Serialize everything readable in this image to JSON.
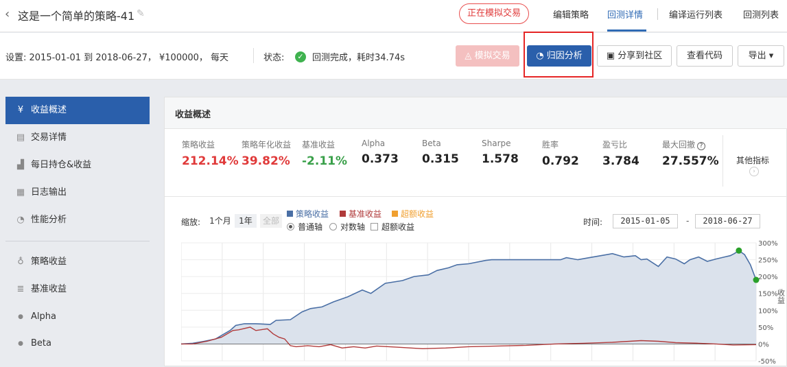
{
  "header": {
    "back_icon": "chevron-left-icon",
    "title": "这是一个简单的策略-41",
    "edit_icon": "pencil-icon",
    "sim_badge": "正在模拟交易",
    "tabs": [
      {
        "label": "编辑策略"
      },
      {
        "label": "回测详情",
        "active": true
      },
      {
        "label": "编译运行列表"
      },
      {
        "label": "回测列表"
      }
    ]
  },
  "info": {
    "settings": "设置:   2015-01-01 到 2018-06-27，  ¥100000，  每天",
    "status_label": "状态:",
    "status_icon": "check-circle-icon",
    "status_text": "回测完成，耗时34.74s",
    "buttons": {
      "sim_trade": "模拟交易",
      "attribution": "归因分析",
      "share": "分享到社区",
      "view_code": "查看代码",
      "export": "导出"
    }
  },
  "sidebar": {
    "items": [
      {
        "label": "收益概述",
        "icon": "yen-icon",
        "active": true
      },
      {
        "label": "交易详情",
        "icon": "document-icon"
      },
      {
        "label": "每日持仓&收益",
        "icon": "bar-chart-icon"
      },
      {
        "label": "日志输出",
        "icon": "calendar-icon"
      },
      {
        "label": "性能分析",
        "icon": "pie-chart-icon"
      },
      {
        "label": "策略收益",
        "icon": "lightbulb-icon"
      },
      {
        "label": "基准收益",
        "icon": "database-icon"
      },
      {
        "label": "Alpha"
      },
      {
        "label": "Beta"
      }
    ]
  },
  "panel": {
    "title": "收益概述",
    "metrics": [
      {
        "label": "策略收益",
        "value": "212.14%",
        "color": "#e03a3a"
      },
      {
        "label": "策略年化收益",
        "value": "39.82%",
        "color": "#e03a3a"
      },
      {
        "label": "基准收益",
        "value": "-2.11%",
        "color": "#3aa04a"
      },
      {
        "label": "Alpha",
        "value": "0.373"
      },
      {
        "label": "Beta",
        "value": "0.315"
      },
      {
        "label": "Sharpe",
        "value": "1.578"
      },
      {
        "label": "胜率",
        "value": "0.792"
      },
      {
        "label": "盈亏比",
        "value": "3.784"
      },
      {
        "label": "最大回撤",
        "value": "27.557%"
      }
    ],
    "other_metrics": "其他指标"
  },
  "chart_controls": {
    "zoom_label": "缩放:",
    "zoom_options": [
      "1个月",
      "1年",
      "全部"
    ],
    "legend": [
      {
        "name": "策略收益",
        "color": "#4a6fa5"
      },
      {
        "name": "基准收益",
        "color": "#b03a3a"
      },
      {
        "name": "超额收益",
        "color": "#f0a030"
      }
    ],
    "axis_options": [
      {
        "label": "普通轴",
        "checked": true
      },
      {
        "label": "对数轴",
        "checked": false
      }
    ],
    "excess_option": "超额收益",
    "time_label": "时间:",
    "date_from": "2015-01-05",
    "date_to": "2018-06-27",
    "date_sep": "-"
  },
  "chart_data": {
    "type": "area",
    "x_range": [
      "2015-01-05",
      "2018-06-27"
    ],
    "y_ticks": [
      "300%",
      "250%",
      "200%",
      "150%",
      "100%",
      "50%",
      "0%",
      "-50%"
    ],
    "ylim": [
      -50,
      300
    ],
    "ylabel_right": "收益",
    "series": [
      {
        "name": "策略收益",
        "color": "#4a6fa5",
        "points": [
          [
            0,
            0
          ],
          [
            0.02,
            2
          ],
          [
            0.04,
            8
          ],
          [
            0.06,
            15
          ],
          [
            0.07,
            25
          ],
          [
            0.085,
            40
          ],
          [
            0.095,
            55
          ],
          [
            0.11,
            60
          ],
          [
            0.13,
            60
          ],
          [
            0.155,
            58
          ],
          [
            0.165,
            70
          ],
          [
            0.19,
            72
          ],
          [
            0.21,
            95
          ],
          [
            0.225,
            105
          ],
          [
            0.245,
            110
          ],
          [
            0.265,
            125
          ],
          [
            0.29,
            140
          ],
          [
            0.315,
            160
          ],
          [
            0.33,
            150
          ],
          [
            0.355,
            180
          ],
          [
            0.385,
            188
          ],
          [
            0.405,
            200
          ],
          [
            0.43,
            205
          ],
          [
            0.445,
            218
          ],
          [
            0.465,
            226
          ],
          [
            0.48,
            235
          ],
          [
            0.5,
            238
          ],
          [
            0.53,
            248
          ],
          [
            0.54,
            250
          ],
          [
            0.66,
            250
          ],
          [
            0.67,
            256
          ],
          [
            0.69,
            250
          ],
          [
            0.71,
            256
          ],
          [
            0.73,
            262
          ],
          [
            0.75,
            268
          ],
          [
            0.77,
            258
          ],
          [
            0.79,
            262
          ],
          [
            0.8,
            250
          ],
          [
            0.81,
            252
          ],
          [
            0.83,
            230
          ],
          [
            0.845,
            258
          ],
          [
            0.86,
            252
          ],
          [
            0.875,
            238
          ],
          [
            0.885,
            250
          ],
          [
            0.9,
            258
          ],
          [
            0.915,
            245
          ],
          [
            0.93,
            252
          ],
          [
            0.945,
            258
          ],
          [
            0.955,
            262
          ],
          [
            0.962,
            268
          ],
          [
            0.97,
            277
          ],
          [
            0.98,
            265
          ],
          [
            0.99,
            235
          ],
          [
            1.0,
            190
          ]
        ]
      },
      {
        "name": "基准收益",
        "color": "#b03a3a",
        "points": [
          [
            0,
            0
          ],
          [
            0.02,
            0
          ],
          [
            0.045,
            8
          ],
          [
            0.07,
            20
          ],
          [
            0.09,
            40
          ],
          [
            0.1,
            42
          ],
          [
            0.12,
            50
          ],
          [
            0.13,
            40
          ],
          [
            0.15,
            45
          ],
          [
            0.16,
            30
          ],
          [
            0.17,
            20
          ],
          [
            0.18,
            15
          ],
          [
            0.19,
            -5
          ],
          [
            0.2,
            -8
          ],
          [
            0.22,
            -5
          ],
          [
            0.24,
            -8
          ],
          [
            0.26,
            -2
          ],
          [
            0.28,
            -12
          ],
          [
            0.3,
            -8
          ],
          [
            0.32,
            -12
          ],
          [
            0.34,
            -6
          ],
          [
            0.38,
            -10
          ],
          [
            0.42,
            -14
          ],
          [
            0.46,
            -12
          ],
          [
            0.5,
            -8
          ],
          [
            0.55,
            -6
          ],
          [
            0.6,
            -4
          ],
          [
            0.65,
            0
          ],
          [
            0.7,
            2
          ],
          [
            0.75,
            5
          ],
          [
            0.8,
            10
          ],
          [
            0.83,
            8
          ],
          [
            0.86,
            4
          ],
          [
            0.9,
            2
          ],
          [
            0.93,
            0
          ],
          [
            0.96,
            -3
          ],
          [
            1.0,
            -2
          ]
        ]
      }
    ],
    "markers": [
      {
        "x": 0.97,
        "y": 277,
        "color": "#2aa02a"
      },
      {
        "x": 1.0,
        "y": 190,
        "color": "#2aa02a"
      }
    ]
  }
}
